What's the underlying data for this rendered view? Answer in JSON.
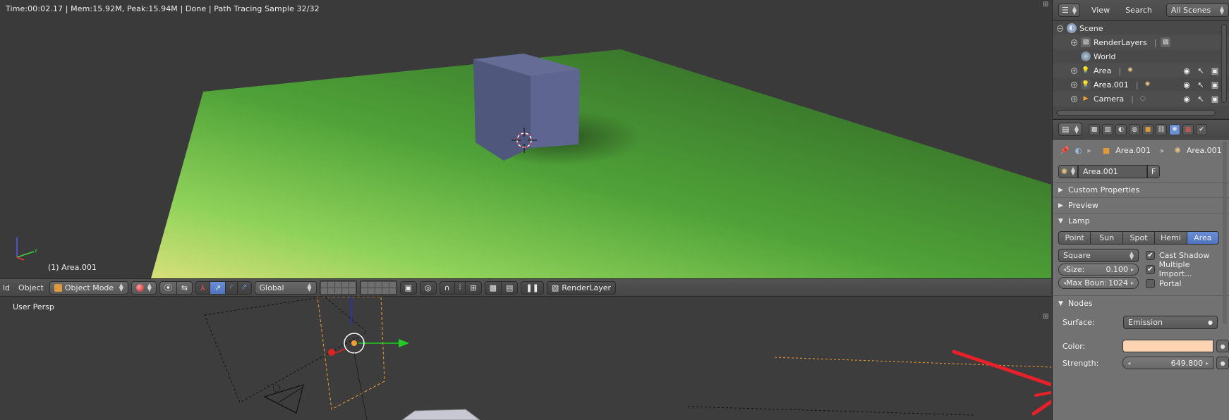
{
  "render_info": "Time:00:02.17 | Mem:15.92M, Peak:15.94M | Done | Path Tracing Sample 32/32",
  "active_object": "(1) Area.001",
  "header": {
    "left_clip": "ld",
    "object_menu": "Object",
    "mode": "Object Mode",
    "orientation": "Global",
    "render_layer": "RenderLayer"
  },
  "bottom_view": {
    "name": "User Persp"
  },
  "outliner": {
    "menu_view": "View",
    "menu_search": "Search",
    "scenes": "All Scenes",
    "items": [
      {
        "label": "Scene",
        "icon": "scene-icon"
      },
      {
        "label": "RenderLayers",
        "icon": "renderlayers-icon"
      },
      {
        "label": "World",
        "icon": "world-icon"
      },
      {
        "label": "Area",
        "icon": "lamp-icon"
      },
      {
        "label": "Area.001",
        "icon": "lamp-icon"
      },
      {
        "label": "Camera",
        "icon": "camera-icon"
      }
    ]
  },
  "properties": {
    "breadcrumb": [
      "Area.001",
      "Area.001"
    ],
    "lamp_datablock": "Area.001",
    "fake_user": "F",
    "panels": {
      "custom_properties": "Custom Properties",
      "preview": "Preview",
      "lamp": "Lamp",
      "nodes": "Nodes"
    },
    "lamp_types": [
      "Point",
      "Sun",
      "Spot",
      "Hemi",
      "Area"
    ],
    "lamp_type_selected": "Area",
    "shape": "Square",
    "size_label": "Size:",
    "size_value": "0.100",
    "max_bounces_label": "Max Boun:",
    "max_bounces_value": "1024",
    "cast_shadow": "Cast Shadow",
    "multiple_importance": "Multiple Import...",
    "portal": "Portal",
    "surface_label": "Surface:",
    "surface_value": "Emission",
    "color_label": "Color:",
    "color_value": "#ffd4b3",
    "strength_label": "Strength:",
    "strength_value": "649.800"
  },
  "colors": {
    "accent": "#5680c2",
    "annotation_arrow": "#e8202a",
    "plane": "#5fb04a",
    "cube": "#5a628a"
  }
}
